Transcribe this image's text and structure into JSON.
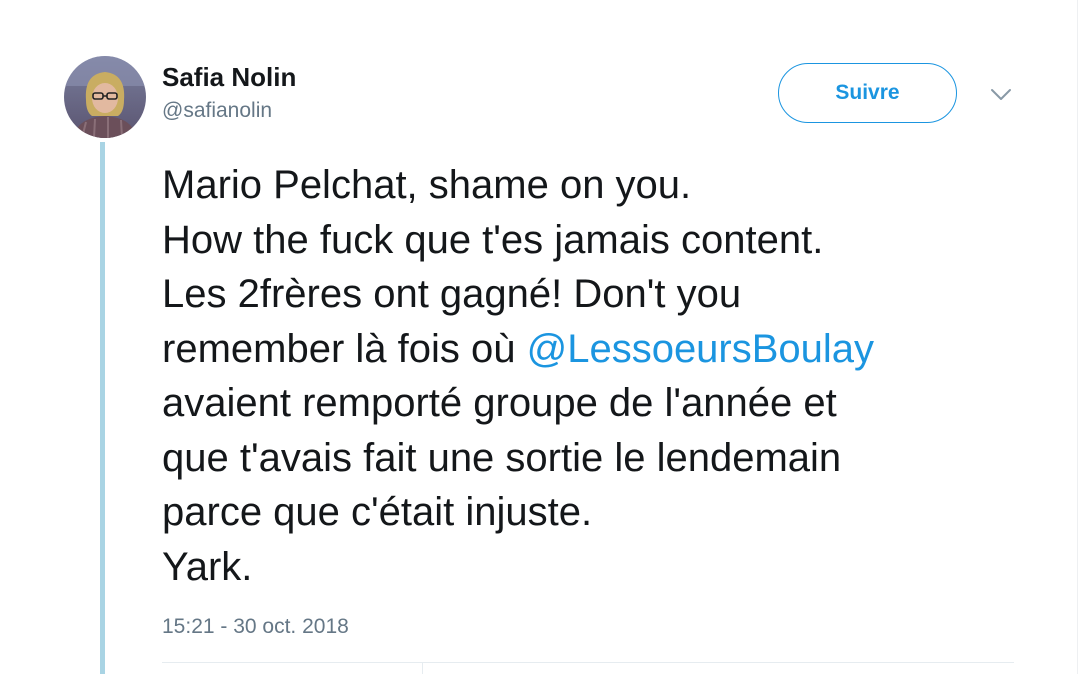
{
  "tweet": {
    "author": {
      "display_name": "Safia Nolin",
      "handle": "@safianolin",
      "avatar_icon": "profile-photo"
    },
    "follow_label": "Suivre",
    "menu_icon": "chevron-down-icon",
    "lines": {
      "l1": "Mario Pelchat, shame on you.",
      "l2": "How the fuck que t'es jamais content.",
      "l3": "Les 2frères ont gagné! Don't you",
      "l4_prefix": "remember là fois où ",
      "l4_mention": "@LessoeursBoulay",
      "l5": "avaient remporté groupe de l'année et",
      "l6": "que t'avais fait une sortie le lendemain",
      "l7": "parce que c'était injuste.",
      "l8": "Yark."
    },
    "timestamp": "15:21 - 30 oct. 2018"
  },
  "colors": {
    "accent": "#1b95e0",
    "thread_line": "#a9d4e4",
    "text": "#14171a",
    "secondary_text": "#657786"
  }
}
